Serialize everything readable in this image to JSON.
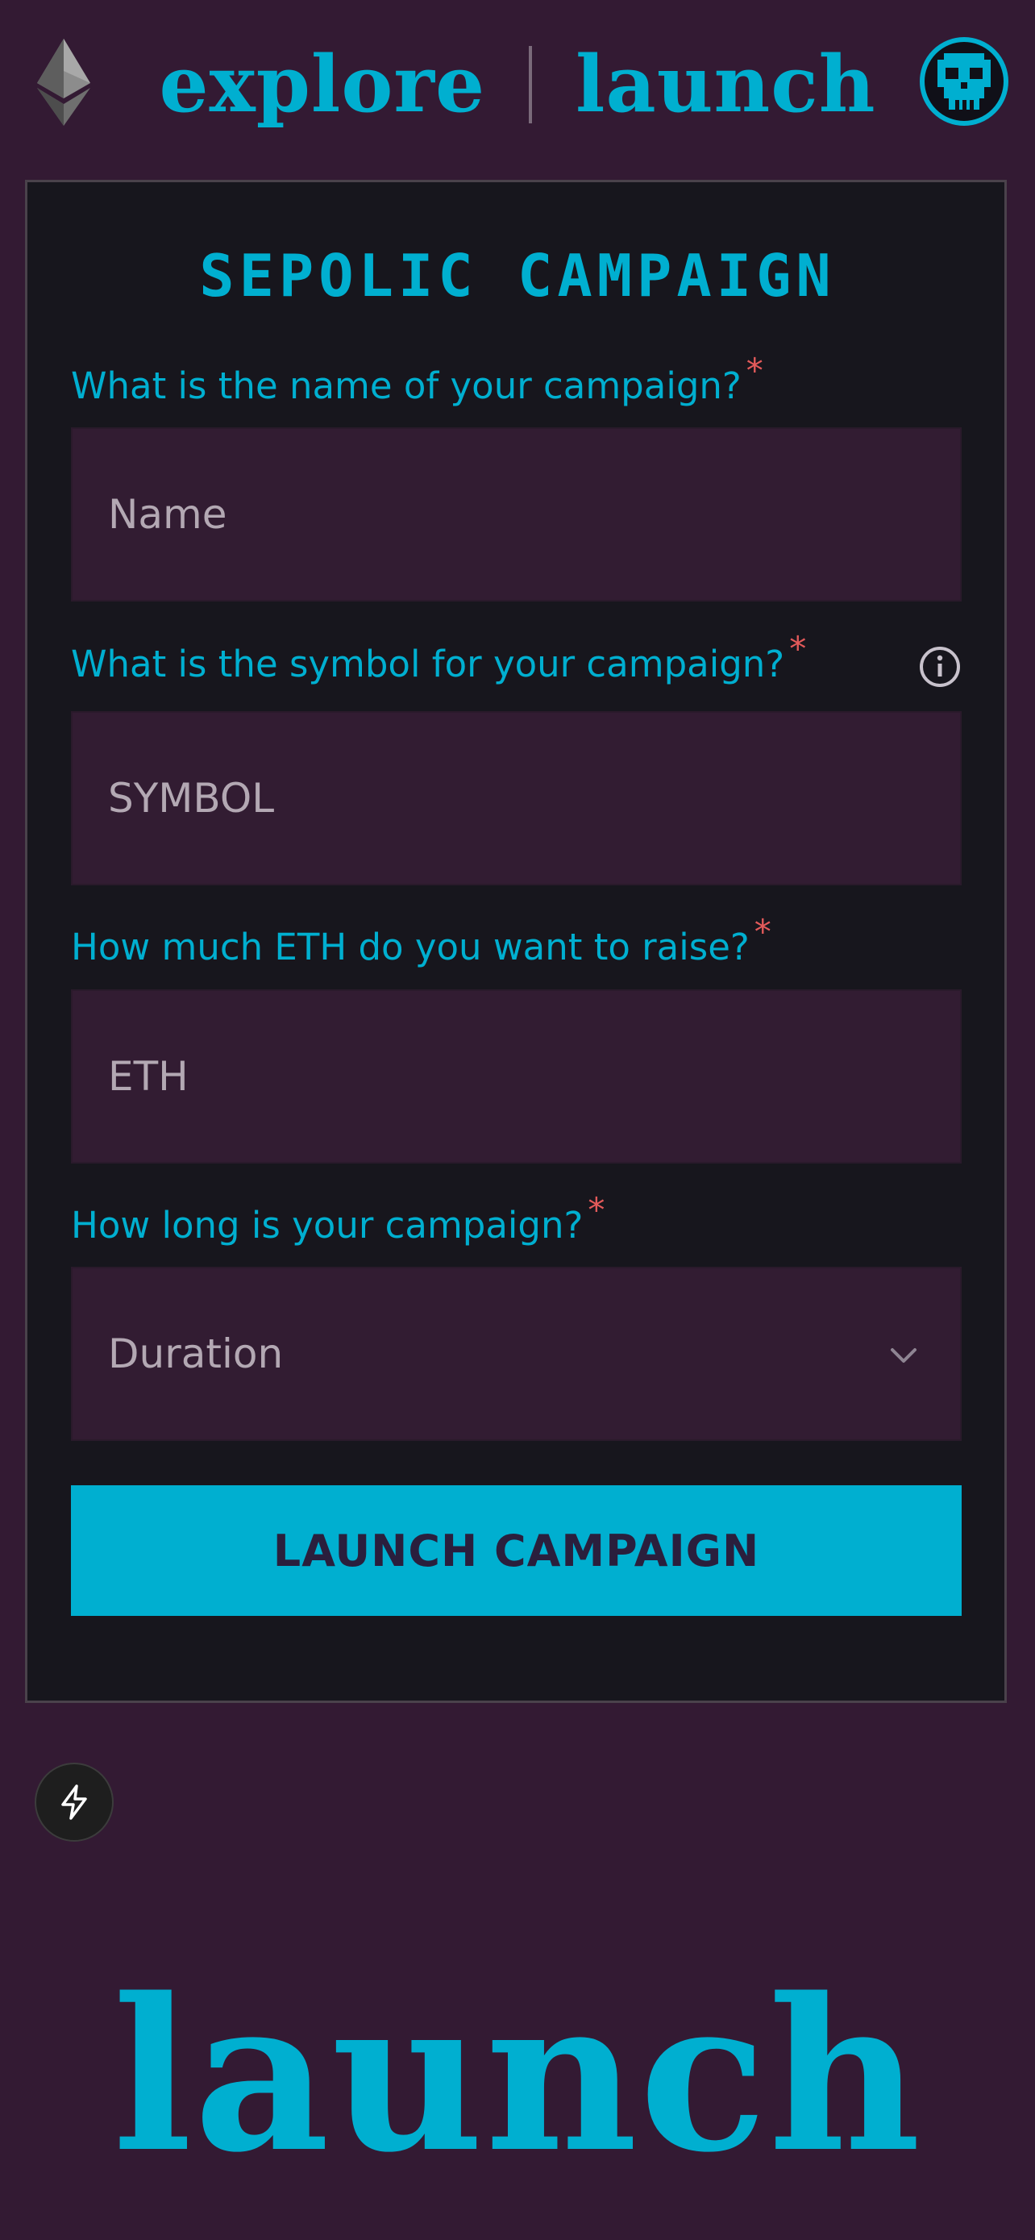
{
  "header": {
    "nav": {
      "explore_label": "explore",
      "launch_label": "launch"
    },
    "logo_icon": "ethereum-icon",
    "avatar_icon": "skull-icon"
  },
  "form": {
    "title": "SEPOLIC CAMPAIGN",
    "required_marker": "*",
    "name": {
      "label": "What is the name of your campaign?",
      "placeholder": "Name",
      "value": ""
    },
    "symbol": {
      "label": "What is the symbol for your campaign?",
      "placeholder": "SYMBOL",
      "value": "",
      "info_icon": "info-icon"
    },
    "eth": {
      "label": "How much ETH do you want to raise?",
      "placeholder": "ETH",
      "value": ""
    },
    "duration": {
      "label": "How long is your campaign?",
      "selected": "Duration",
      "icon": "chevron-down-icon"
    },
    "submit_label": "LAUNCH CAMPAIGN"
  },
  "floating_button": {
    "icon": "lightning-bolt-icon"
  },
  "footer": {
    "brand": "launch"
  },
  "colors": {
    "page_background": "#331a33",
    "card_background": "#17161d",
    "accent": "#00afd0",
    "field_background": "#321c32",
    "required": "#e35a5a",
    "button_text": "#2a1f3d"
  }
}
